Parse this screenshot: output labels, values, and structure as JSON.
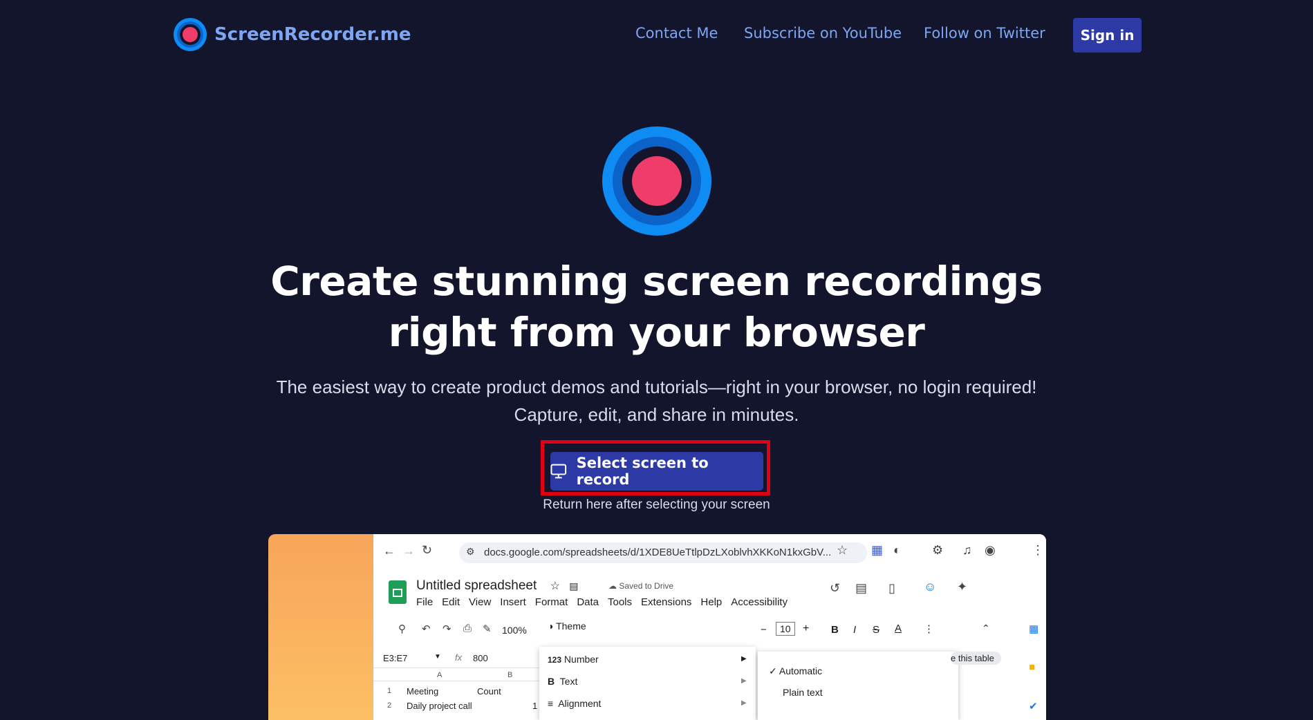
{
  "nav": {
    "brand": "ScreenRecorder.me",
    "links": [
      "Contact Me",
      "Subscribe on YouTube",
      "Follow on Twitter"
    ],
    "signin": "Sign in"
  },
  "hero": {
    "title_line1": "Create stunning screen recordings",
    "title_line2": "right from your browser",
    "subtitle_line1": "The easiest way to create product demos and tutorials—right in your browser, no login required!",
    "subtitle_line2": "Capture, edit, and share in minutes.",
    "cta": "Select screen to record",
    "cta_note": "Return here after selecting your screen"
  },
  "preview": {
    "url": "docs.google.com/spreadsheets/d/1XDE8UeTtlpDzLXoblvhXKKoN1kxGbV...",
    "doc_title": "Untitled spreadsheet",
    "saved": "Saved to Drive",
    "menu": [
      "File",
      "Edit",
      "View",
      "Insert",
      "Format",
      "Data",
      "Tools",
      "Extensions",
      "Help",
      "Accessibility"
    ],
    "zoom": "100%",
    "font_size": "10",
    "cell_ref": "E3:E7",
    "formula": "800",
    "format_menu": [
      "Theme",
      "Number",
      "Text",
      "Alignment"
    ],
    "number_submenu": [
      "Automatic",
      "Plain text"
    ],
    "table_hint": "e this table",
    "col_a": "A",
    "col_b": "B",
    "rows": [
      {
        "num": "1",
        "a": "Meeting",
        "b": "Count"
      },
      {
        "num": "2",
        "a": "Daily project call",
        "b": "1"
      }
    ]
  },
  "colors": {
    "background": "#12152b",
    "accent": "#2d3aa6",
    "link": "#7ea6f2",
    "record_red": "#ee3d6b",
    "record_blue": "#0e8cf3",
    "highlight": "#e00012"
  }
}
